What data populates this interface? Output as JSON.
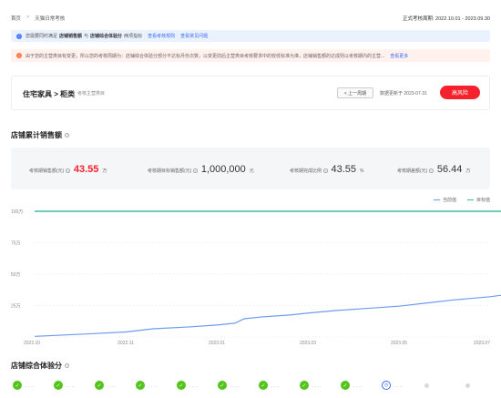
{
  "breadcrumb": {
    "home": "首页",
    "sep": ">",
    "current": "天猫日常考核"
  },
  "period": "正式考核周期: 2022.10.01 - 2023.09.30",
  "info_bar": {
    "text_1": "您需要同时满足",
    "bold_1": "店铺销售额",
    "text_2": "与",
    "bold_2": "店铺综合体验分",
    "text_3": "两项指标",
    "link_1": "查看考核规则",
    "link_2": "查看常见问题"
  },
  "warn_bar": {
    "text": "由于您的主营类目有变更，所以您的考核周期为：店铺综合体验分部分不达标月份次数，以变更前后主营类目考核要求中的较低标准为准，店铺销售额的达成则以考核期内的主营...",
    "link": "查看更多"
  },
  "category": {
    "title": "住宅家具 > 柜类",
    "subtitle": "考核主营类目",
    "prev_button": "< 上一周期",
    "updated": "数据更新于 2023-07-31",
    "risk_button": "高风险"
  },
  "sales_section": {
    "title": "店铺累计销售额"
  },
  "metrics": [
    {
      "label": "考核期销售额(元)",
      "value": "43.55",
      "unit": "万",
      "highlight": true
    },
    {
      "label": "考核期目标销售额(元)",
      "value": "1,000,000",
      "unit": "元",
      "highlight": false
    },
    {
      "label": "考核期完成比例",
      "value": "43.55",
      "unit": "%",
      "highlight": false
    },
    {
      "label": "考核期差额(元)",
      "value": "56.44",
      "unit": "万",
      "highlight": false
    }
  ],
  "colors": {
    "current": "#6b9cf0",
    "target": "#3dbf9f",
    "risk": "#f5222d",
    "pass": "#52c41a",
    "link": "#3b6cf6"
  },
  "chart_data": {
    "type": "line",
    "x_ticks": [
      "2022.10",
      "2022.11",
      "2023.01",
      "2023.03",
      "2023.05",
      "2023.07"
    ],
    "y_ticks": [
      "100万",
      "75万",
      "50万",
      "25万"
    ],
    "ylim": [
      0,
      100
    ],
    "series": [
      {
        "name": "当前值",
        "color": "#6b9cf0",
        "x": [
          0,
          0.3,
          0.6,
          1.0,
          1.3,
          1.7,
          2.0,
          2.2,
          2.3,
          2.5,
          2.8,
          3.0,
          3.3,
          3.6,
          4.0,
          4.3,
          4.6,
          5.0,
          5.3,
          5.6,
          5.85,
          6.0
        ],
        "values": [
          0.5,
          1.5,
          2.5,
          4.0,
          6.5,
          8.0,
          9.5,
          11.0,
          14.5,
          16.0,
          17.5,
          19.0,
          21.0,
          22.5,
          24.5,
          27.0,
          29.5,
          32.0,
          35.0,
          38.0,
          41.0,
          43.55
        ]
      },
      {
        "name": "目标值",
        "color": "#3dbf9f",
        "x": [
          0,
          6.0
        ],
        "values": [
          100,
          100
        ]
      }
    ],
    "grid": true,
    "legend": "top-right"
  },
  "experience_section": {
    "title": "店铺综合体验分"
  },
  "steps": [
    "pass",
    "pass",
    "pass",
    "pass",
    "pass",
    "pass",
    "pass",
    "pass",
    "pass",
    "pending",
    "future",
    "future"
  ]
}
